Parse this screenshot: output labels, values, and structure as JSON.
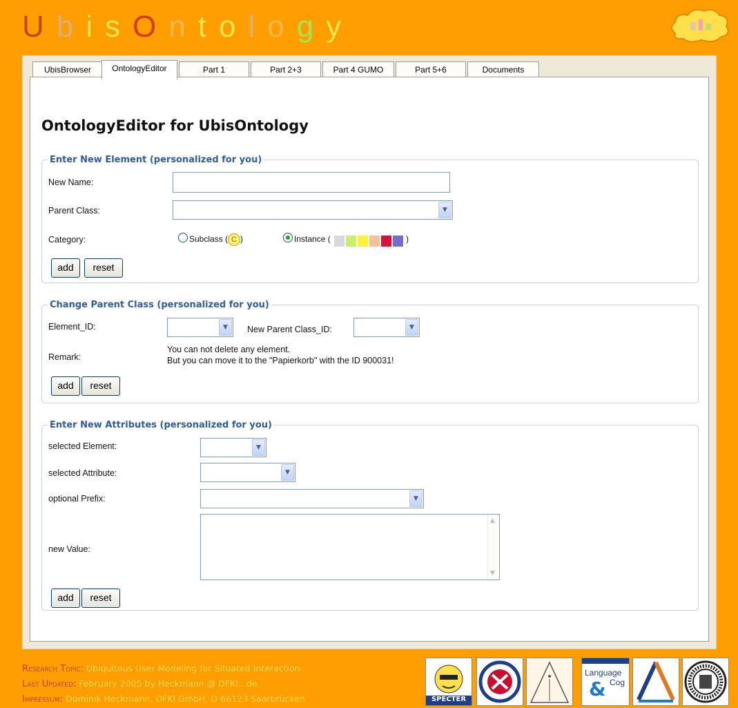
{
  "header": {
    "logo_letters": [
      {
        "ch": "U",
        "color": "#C0461A"
      },
      {
        "ch": "b",
        "color": "#D9B07A"
      },
      {
        "ch": "i",
        "color": "#FFE54A"
      },
      {
        "ch": "s",
        "color": "#FFE54A"
      },
      {
        "ch": "O",
        "color": "#D23A10"
      },
      {
        "ch": "n",
        "color": "#FFB84A"
      },
      {
        "ch": "t",
        "color": "#FFE54A"
      },
      {
        "ch": "o",
        "color": "#FFE54A"
      },
      {
        "ch": "l",
        "color": "#D9B07A"
      },
      {
        "ch": "o",
        "color": "#FFB84A"
      },
      {
        "ch": "g",
        "color": "#A6E34C"
      },
      {
        "ch": "y",
        "color": "#FFE54A"
      }
    ],
    "cloud_icon": "cloud-logo-icon"
  },
  "tabs": [
    "UbisBrowser",
    "OntologyEditor",
    "Part 1",
    "Part 2+3",
    "Part 4 GUMO",
    "Part 5+6",
    "Documents"
  ],
  "active_tab": "OntologyEditor",
  "page_title": "OntologyEditor for UbisOntology",
  "new_element": {
    "legend": "Enter New Element (personalized for you)",
    "name_label": "New Name:",
    "name_value": "",
    "parent_label": "Parent Class:",
    "parent_value": "",
    "category_label": "Category:",
    "subclass_label": "Subclass (",
    "subclass_icon_text": "C",
    "subclass_end": ")",
    "instance_label": "Instance (",
    "instance_end": ")",
    "instance_selected": true,
    "instance_colors": [
      "#D9D9D9",
      "#C8F06A",
      "#FFF23C",
      "#F6C09A",
      "#D4143C",
      "#7070CC"
    ],
    "add_label": "add",
    "reset_label": "reset"
  },
  "change_parent": {
    "legend": "Change Parent Class (personalized for you)",
    "element_id_label": "Element_ID:",
    "new_parent_label": "New Parent Class_ID:",
    "remark_label": "Remark:",
    "remark_line1": "You can not delete any element.",
    "remark_line2": "But you can move it to the \"Papierkorb\" with the ID 900031!",
    "add_label": "add",
    "reset_label": "reset"
  },
  "new_attributes": {
    "legend": "Enter New Attributes (personalized for you)",
    "element_label": "selected Element:",
    "attribute_label": "selected Attribute:",
    "prefix_label": "optional Prefix:",
    "value_label": "new Value:",
    "value_text": "",
    "add_label": "add",
    "reset_label": "reset"
  },
  "footer": {
    "topic_key": "Research Topic:",
    "topic_value": " Ubiquitous User Modeling for Situated Interaction",
    "updated_key": "Last Updated:",
    "updated_value": " February 2005 by Heckmann @ DFKI . de",
    "impressum_key": "Impressum:",
    "impressum_value": " Dominik Heckmann, DFKI GmbH, D-66123 Saarbrücken",
    "logos": [
      "specter-logo",
      "edinburgh-university-logo",
      "architecture-logo",
      "language-and-cognition-logo",
      "triangle-logo",
      "universitas-saraviensis-logo"
    ],
    "specter_text": "SPECTER",
    "language_text": "Language",
    "cog_text": "Cog"
  }
}
